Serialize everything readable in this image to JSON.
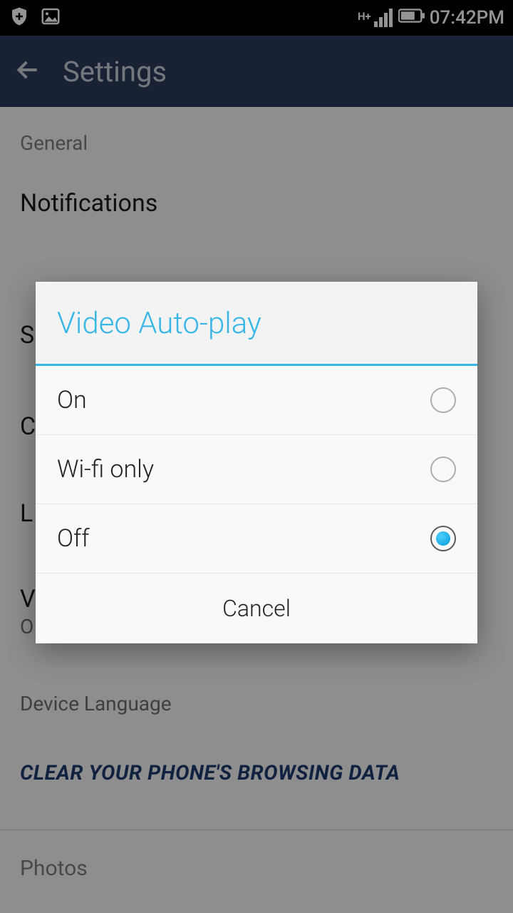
{
  "status_bar": {
    "time": "07:42PM",
    "network_indicator": "H+"
  },
  "app_bar": {
    "title": "Settings"
  },
  "settings": {
    "section_general": "General",
    "notifications": "Notifications",
    "partial_s": "S",
    "partial_c": "C",
    "partial_l": "L",
    "partial_v": "V",
    "partial_o": "O",
    "language_title_fragment": "L...guage",
    "language_sub": "Device Language",
    "clear_data": "CLEAR YOUR PHONE'S BROWSING DATA",
    "section_photos": "Photos"
  },
  "dialog": {
    "title": "Video Auto-play",
    "options": [
      {
        "label": "On",
        "selected": false
      },
      {
        "label": "Wi-fi only",
        "selected": false
      },
      {
        "label": "Off",
        "selected": true
      }
    ],
    "cancel": "Cancel"
  }
}
